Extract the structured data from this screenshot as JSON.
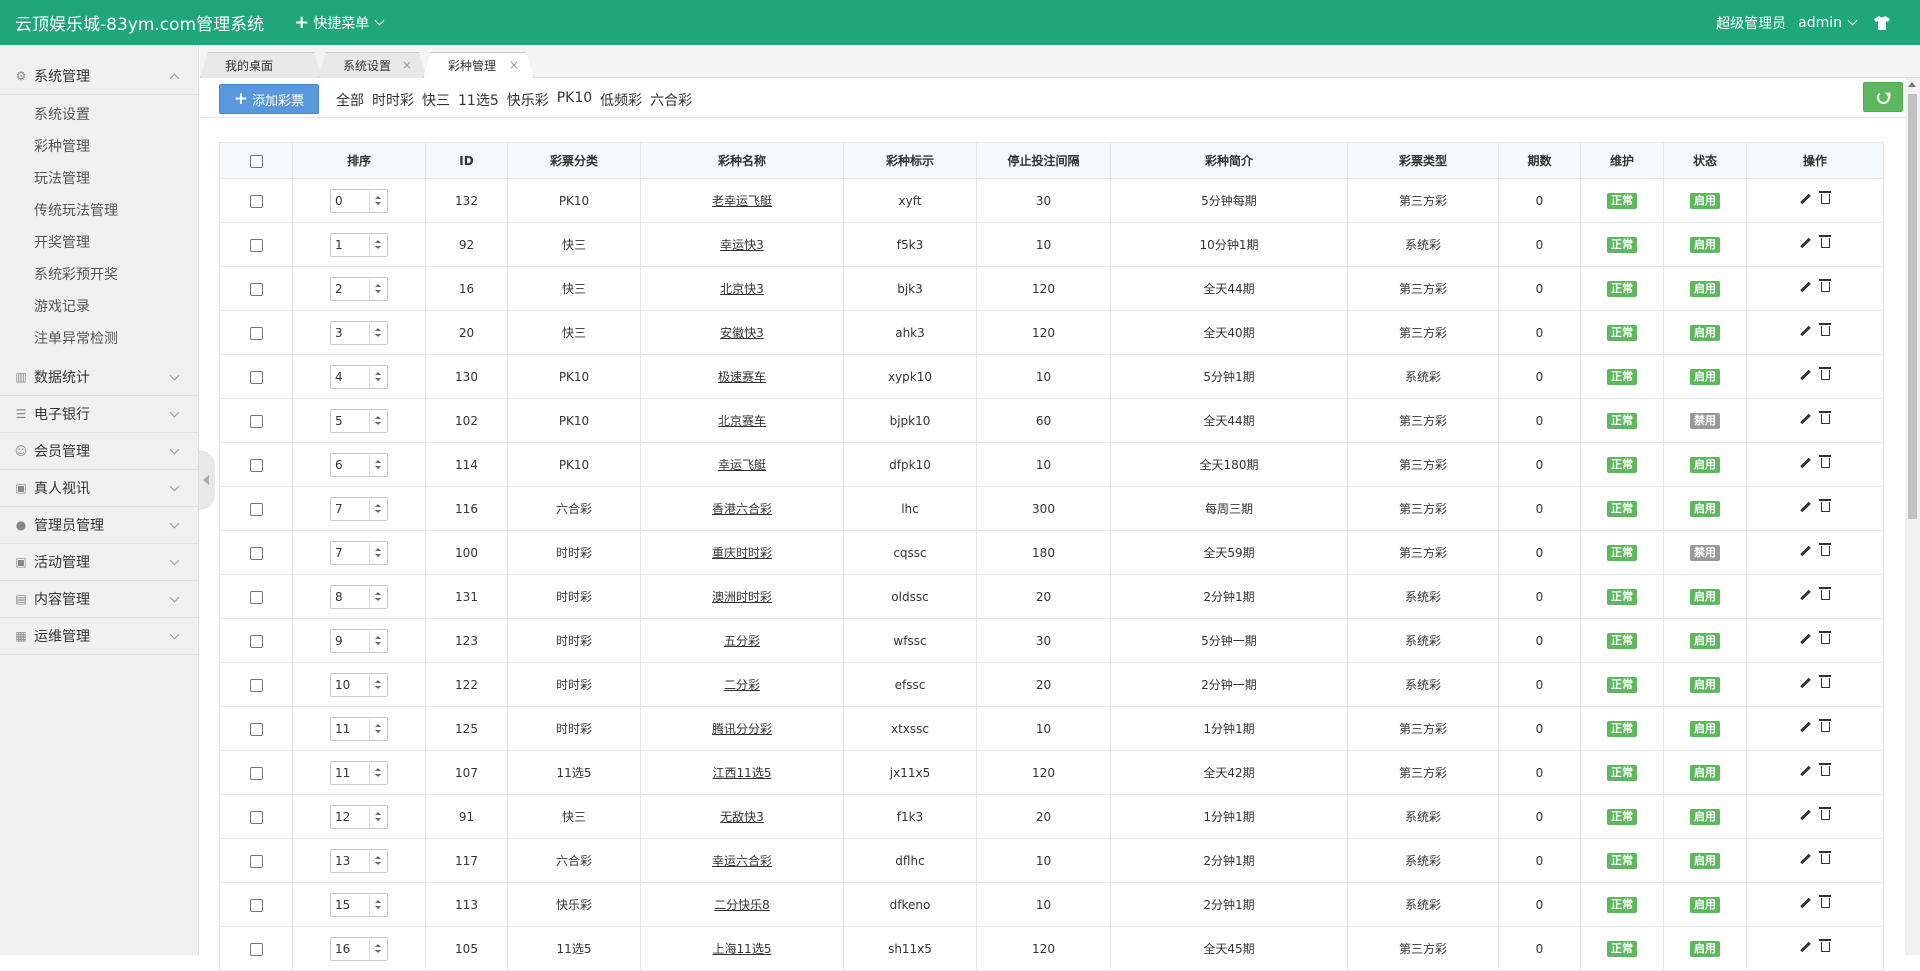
{
  "header": {
    "brand": "云顶娱乐城-83ym.com管理系统",
    "quick_menu": "快捷菜单",
    "role": "超级管理员",
    "user": "admin"
  },
  "sidebar": {
    "groups": [
      {
        "label": "系统管理",
        "icon": "gear-icon",
        "open": true,
        "items": [
          "系统设置",
          "彩种管理",
          "玩法管理",
          "传统玩法管理",
          "开奖管理",
          "系统彩预开奖",
          "游戏记录",
          "注单异常检测"
        ]
      },
      {
        "label": "数据统计",
        "icon": "chart-icon"
      },
      {
        "label": "电子银行",
        "icon": "list-icon"
      },
      {
        "label": "会员管理",
        "icon": "user-icon"
      },
      {
        "label": "真人视讯",
        "icon": "gift-icon"
      },
      {
        "label": "管理员管理",
        "icon": "admin-icon"
      },
      {
        "label": "活动管理",
        "icon": "gift-icon"
      },
      {
        "label": "内容管理",
        "icon": "content-icon"
      },
      {
        "label": "运维管理",
        "icon": "ops-icon"
      }
    ]
  },
  "tabs": [
    {
      "label": "我的桌面",
      "active": false
    },
    {
      "label": "系统设置",
      "active": false
    },
    {
      "label": "彩种管理",
      "active": true
    }
  ],
  "toolbar": {
    "add_label": "添加彩票",
    "filters": [
      "全部",
      "时时彩",
      "快三",
      "11选5",
      "快乐彩",
      "PK10",
      "低频彩",
      "六合彩"
    ]
  },
  "table": {
    "headers": [
      "排序",
      "ID",
      "彩票分类",
      "彩种名称",
      "彩种标示",
      "停止投注间隔",
      "彩种简介",
      "彩票类型",
      "期数",
      "维护",
      "状态",
      "操作"
    ],
    "rows": [
      {
        "sort": "0",
        "id": "132",
        "category": "PK10",
        "name": "老幸运飞艇",
        "code": "xyft",
        "interval": "30",
        "intro": "5分钟每期",
        "type": "第三方彩",
        "periods": "0",
        "maint": "正常",
        "status": "启用"
      },
      {
        "sort": "1",
        "id": "92",
        "category": "快三",
        "name": "幸运快3",
        "code": "f5k3",
        "interval": "10",
        "intro": "10分钟1期",
        "type": "系统彩",
        "periods": "0",
        "maint": "正常",
        "status": "启用"
      },
      {
        "sort": "2",
        "id": "16",
        "category": "快三",
        "name": "北京快3",
        "code": "bjk3",
        "interval": "120",
        "intro": "全天44期",
        "type": "第三方彩",
        "periods": "0",
        "maint": "正常",
        "status": "启用"
      },
      {
        "sort": "3",
        "id": "20",
        "category": "快三",
        "name": "安徽快3",
        "code": "ahk3",
        "interval": "120",
        "intro": "全天40期",
        "type": "第三方彩",
        "periods": "0",
        "maint": "正常",
        "status": "启用"
      },
      {
        "sort": "4",
        "id": "130",
        "category": "PK10",
        "name": "极速赛车",
        "code": "xypk10",
        "interval": "10",
        "intro": "5分钟1期",
        "type": "系统彩",
        "periods": "0",
        "maint": "正常",
        "status": "启用"
      },
      {
        "sort": "5",
        "id": "102",
        "category": "PK10",
        "name": "北京赛车",
        "code": "bjpk10",
        "interval": "60",
        "intro": "全天44期",
        "type": "第三方彩",
        "periods": "0",
        "maint": "正常",
        "status": "禁用"
      },
      {
        "sort": "6",
        "id": "114",
        "category": "PK10",
        "name": "幸运飞艇",
        "code": "dfpk10",
        "interval": "10",
        "intro": "全天180期",
        "type": "第三方彩",
        "periods": "0",
        "maint": "正常",
        "status": "启用"
      },
      {
        "sort": "7",
        "id": "116",
        "category": "六合彩",
        "name": "香港六合彩",
        "code": "lhc",
        "interval": "300",
        "intro": "每周三期",
        "type": "第三方彩",
        "periods": "0",
        "maint": "正常",
        "status": "启用"
      },
      {
        "sort": "7",
        "id": "100",
        "category": "时时彩",
        "name": "重庆时时彩",
        "code": "cqssc",
        "interval": "180",
        "intro": "全天59期",
        "type": "第三方彩",
        "periods": "0",
        "maint": "正常",
        "status": "禁用"
      },
      {
        "sort": "8",
        "id": "131",
        "category": "时时彩",
        "name": "澳洲时时彩",
        "code": "oldssc",
        "interval": "20",
        "intro": "2分钟1期",
        "type": "系统彩",
        "periods": "0",
        "maint": "正常",
        "status": "启用"
      },
      {
        "sort": "9",
        "id": "123",
        "category": "时时彩",
        "name": "五分彩",
        "code": "wfssc",
        "interval": "30",
        "intro": "5分钟一期",
        "type": "系统彩",
        "periods": "0",
        "maint": "正常",
        "status": "启用"
      },
      {
        "sort": "10",
        "id": "122",
        "category": "时时彩",
        "name": "二分彩",
        "code": "efssc",
        "interval": "20",
        "intro": "2分钟一期",
        "type": "系统彩",
        "periods": "0",
        "maint": "正常",
        "status": "启用"
      },
      {
        "sort": "11",
        "id": "125",
        "category": "时时彩",
        "name": "腾讯分分彩",
        "code": "xtxssc",
        "interval": "10",
        "intro": "1分钟1期",
        "type": "第三方彩",
        "periods": "0",
        "maint": "正常",
        "status": "启用"
      },
      {
        "sort": "11",
        "id": "107",
        "category": "11选5",
        "name": "江西11选5",
        "code": "jx11x5",
        "interval": "120",
        "intro": "全天42期",
        "type": "第三方彩",
        "periods": "0",
        "maint": "正常",
        "status": "启用"
      },
      {
        "sort": "12",
        "id": "91",
        "category": "快三",
        "name": "无敌快3",
        "code": "f1k3",
        "interval": "20",
        "intro": "1分钟1期",
        "type": "系统彩",
        "periods": "0",
        "maint": "正常",
        "status": "启用"
      },
      {
        "sort": "13",
        "id": "117",
        "category": "六合彩",
        "name": "幸运六合彩",
        "code": "dflhc",
        "interval": "10",
        "intro": "2分钟1期",
        "type": "系统彩",
        "periods": "0",
        "maint": "正常",
        "status": "启用"
      },
      {
        "sort": "15",
        "id": "113",
        "category": "快乐彩",
        "name": "二分快乐8",
        "code": "dfkeno",
        "interval": "10",
        "intro": "2分钟1期",
        "type": "系统彩",
        "periods": "0",
        "maint": "正常",
        "status": "启用"
      },
      {
        "sort": "16",
        "id": "105",
        "category": "11选5",
        "name": "上海11选5",
        "code": "sh11x5",
        "interval": "120",
        "intro": "全天45期",
        "type": "第三方彩",
        "periods": "0",
        "maint": "正常",
        "status": "启用"
      }
    ]
  },
  "colors": {
    "header_bg": "#1fa77a",
    "primary_button": "#5a98de",
    "badge_green": "#5cb85c",
    "badge_gray": "#999999"
  }
}
